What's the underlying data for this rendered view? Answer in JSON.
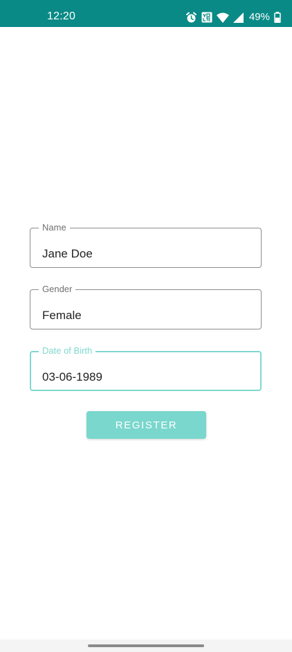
{
  "status_bar": {
    "time": "12:20",
    "battery_percent": "49%",
    "icons": [
      "alarm-icon",
      "volte-icon",
      "wifi-icon",
      "signal-icon",
      "battery-icon"
    ],
    "background_color": "#0a8a86"
  },
  "form": {
    "fields": [
      {
        "label": "Name",
        "value": "Jane Doe",
        "focused": false
      },
      {
        "label": "Gender",
        "value": "Female",
        "focused": false
      },
      {
        "label": "Date of Birth",
        "value": "03-06-1989",
        "focused": true
      }
    ],
    "register_label": "REGISTER",
    "accent_color": "#7ad7cd"
  }
}
